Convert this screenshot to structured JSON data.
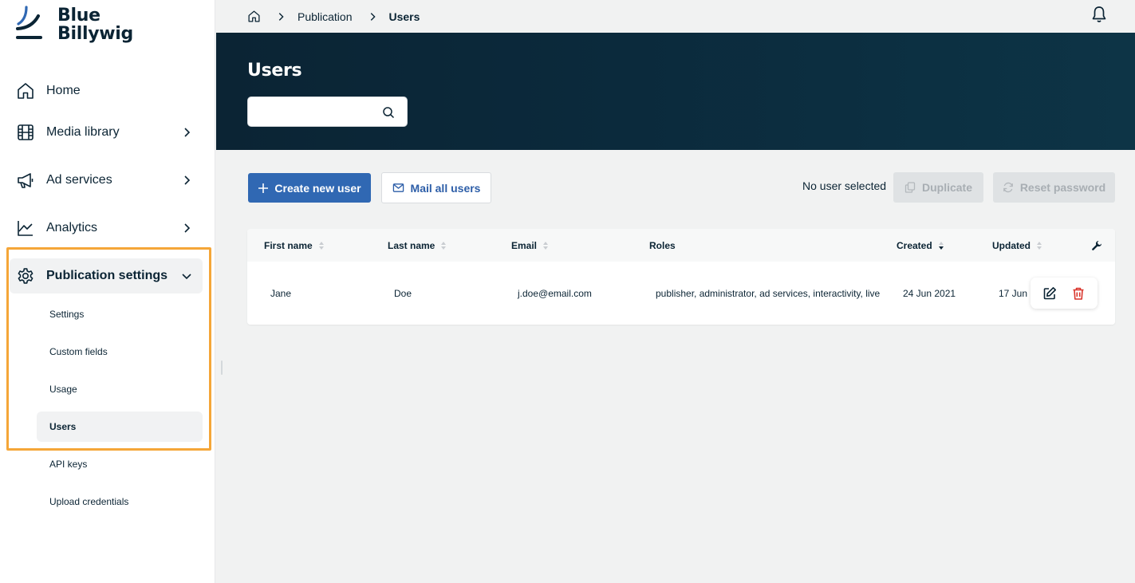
{
  "brand": {
    "line1": "Blue",
    "line2": "Billywig",
    "color": "#0b2434"
  },
  "sidebar": {
    "items": [
      {
        "label": "Home",
        "icon": "home-icon"
      },
      {
        "label": "Media library",
        "icon": "film-icon",
        "chevron": "right"
      },
      {
        "label": "Ad services",
        "icon": "megaphone-icon",
        "chevron": "right"
      },
      {
        "label": "Analytics",
        "icon": "line-chart-icon",
        "chevron": "right"
      },
      {
        "label": "Publication settings",
        "icon": "gear-icon",
        "chevron": "down",
        "expanded": true
      }
    ],
    "subitems": [
      {
        "label": "Settings"
      },
      {
        "label": "Custom fields"
      },
      {
        "label": "Usage"
      },
      {
        "label": "Users",
        "active": true
      },
      {
        "label": "API keys"
      },
      {
        "label": "Upload credentials"
      }
    ],
    "highlight_color": "#f5a638"
  },
  "breadcrumb": {
    "home_icon": "home-icon",
    "items": [
      "Publication",
      "Users"
    ]
  },
  "header": {
    "title": "Users",
    "search": {
      "value": "",
      "placeholder": ""
    }
  },
  "toolbar": {
    "create_label": "Create new user",
    "mail_label": "Mail all users",
    "selection_status": "No user selected",
    "duplicate_label": "Duplicate",
    "reset_label": "Reset password",
    "primary_color": "#3068b3"
  },
  "table": {
    "columns": [
      "First name",
      "Last name",
      "Email",
      "Roles",
      "Created",
      "Updated"
    ],
    "rows": [
      {
        "first_name": "Jane",
        "last_name": "Doe",
        "email": "j.doe@email.com",
        "roles": "publisher, administrator, ad services, interactivity, live",
        "created": "24 Jun 2021",
        "updated": "17 Jun"
      }
    ]
  },
  "colors": {
    "hero_bg": "#0b2434",
    "delete": "#d9342b",
    "page_bg": "#f1f2f2"
  }
}
